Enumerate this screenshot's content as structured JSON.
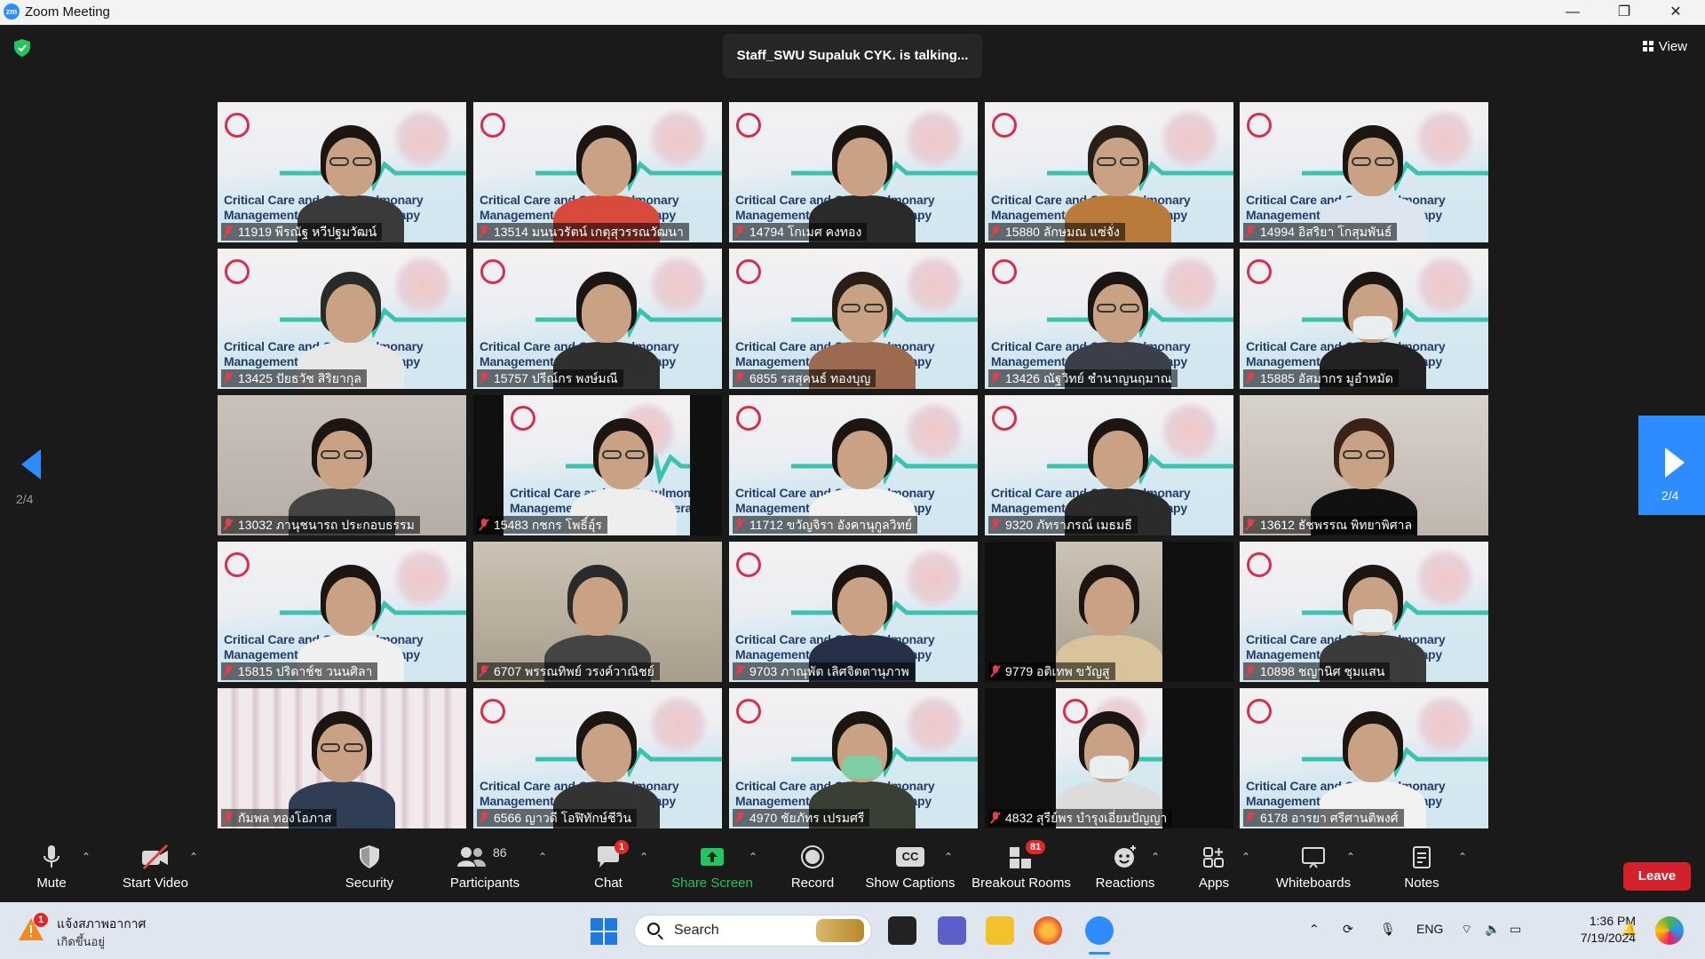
{
  "window": {
    "title": "Zoom Meeting",
    "app_icon_text": "zm",
    "controls": [
      "—",
      "❐",
      "✕"
    ]
  },
  "meeting": {
    "talking_banner": "Staff_SWU Supaluk CYK. is talking...",
    "view_label": "View",
    "page_left": "2/4",
    "page_right": "2/4",
    "slide_line1": "Critical Care and Cardiopulmonary",
    "slide_line2": "Management for Physical Therapy",
    "participants": [
      {
        "name": "11919 พีรณัฐ หวีปฐมวัฒน์"
      },
      {
        "name": "13514 มนนวรัตน์ เกตุสุวรรณวัฒนา"
      },
      {
        "name": "14794 โกเมศ คงทอง"
      },
      {
        "name": "15880 ลักษมณ แซ่จั่ง"
      },
      {
        "name": "14994 อิสริยา โกสุมพันธ์"
      },
      {
        "name": "13425 ปัยธวัช สิริยากุล"
      },
      {
        "name": "15757 ปรีณ์กร พงษ์มณี"
      },
      {
        "name": "6855 รสสุคนธ์ ทองบุญ"
      },
      {
        "name": "13426 ณัฐวิทย์ ชำนาญนฤมาณ"
      },
      {
        "name": "15885 อัสมากร มูอำหมัด"
      },
      {
        "name": "13032 ภานุชนารถ ประกอบธรรม"
      },
      {
        "name": "15483 กชกร โพธิ์อุ์ร"
      },
      {
        "name": "11712 ขวัญจิรา อังคานุกูลวิทย์"
      },
      {
        "name": "9320 ภัทราภรณ์ เมธมธี"
      },
      {
        "name": "13612 ธัชพรรณ พิทยาพิศาล"
      },
      {
        "name": "15815 ปริดาช์ช วนนศิลา"
      },
      {
        "name": "6707 พรรณทิพย์ วรงค์วาณิชย์"
      },
      {
        "name": "9703 ภาณุพัต เลิศจิตตานุภาพ"
      },
      {
        "name": "9779 อติเทพ ขวัญสู"
      },
      {
        "name": "10898 ชญานิศ ชุมแสน"
      },
      {
        "name": "กัมพล ทองโอภาส"
      },
      {
        "name": "6566 ญาวดี โอฬิทักษ์ชีวิน"
      },
      {
        "name": "4970 ชัยภัทร เปรมศรี"
      },
      {
        "name": "4832 สุรีย์พร บำรุงเอี่ยมปัญญา"
      },
      {
        "name": "6178 อารยา ศรีศานติพงศ์"
      }
    ]
  },
  "toolbar": {
    "mute": "Mute",
    "start_video": "Start Video",
    "security": "Security",
    "participants": "Participants",
    "participants_count": "86",
    "chat": "Chat",
    "chat_badge": "1",
    "share_screen": "Share Screen",
    "record": "Record",
    "show_captions": "Show Captions",
    "captions_icon_text": "CC",
    "breakout_rooms": "Breakout Rooms",
    "breakout_badge": "81",
    "reactions": "Reactions",
    "apps": "Apps",
    "whiteboards": "Whiteboards",
    "notes": "Notes",
    "leave": "Leave",
    "colors": {
      "accent": "#2d8cff",
      "share_green": "#22c55e",
      "leave_red": "#d4202a",
      "badge_red": "#e02828"
    }
  },
  "taskbar": {
    "weather_line1": "แจ้งสภาพอากาศ",
    "weather_line2": "เกิดขึ้นอยู่",
    "weather_badge": "1",
    "search_label": "Search",
    "language": "ENG",
    "time": "1:36 PM",
    "date": "7/19/2024"
  }
}
